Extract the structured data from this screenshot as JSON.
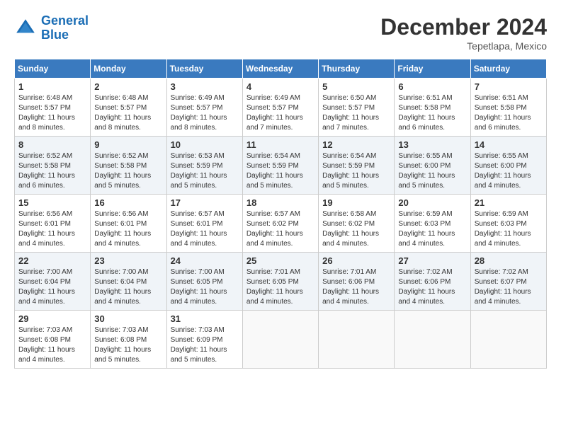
{
  "header": {
    "logo_line1": "General",
    "logo_line2": "Blue",
    "month": "December 2024",
    "location": "Tepetlapa, Mexico"
  },
  "weekdays": [
    "Sunday",
    "Monday",
    "Tuesday",
    "Wednesday",
    "Thursday",
    "Friday",
    "Saturday"
  ],
  "weeks": [
    [
      {
        "day": "1",
        "sunrise": "6:48 AM",
        "sunset": "5:57 PM",
        "daylight": "11 hours and 8 minutes."
      },
      {
        "day": "2",
        "sunrise": "6:48 AM",
        "sunset": "5:57 PM",
        "daylight": "11 hours and 8 minutes."
      },
      {
        "day": "3",
        "sunrise": "6:49 AM",
        "sunset": "5:57 PM",
        "daylight": "11 hours and 8 minutes."
      },
      {
        "day": "4",
        "sunrise": "6:49 AM",
        "sunset": "5:57 PM",
        "daylight": "11 hours and 7 minutes."
      },
      {
        "day": "5",
        "sunrise": "6:50 AM",
        "sunset": "5:57 PM",
        "daylight": "11 hours and 7 minutes."
      },
      {
        "day": "6",
        "sunrise": "6:51 AM",
        "sunset": "5:58 PM",
        "daylight": "11 hours and 6 minutes."
      },
      {
        "day": "7",
        "sunrise": "6:51 AM",
        "sunset": "5:58 PM",
        "daylight": "11 hours and 6 minutes."
      }
    ],
    [
      {
        "day": "8",
        "sunrise": "6:52 AM",
        "sunset": "5:58 PM",
        "daylight": "11 hours and 6 minutes."
      },
      {
        "day": "9",
        "sunrise": "6:52 AM",
        "sunset": "5:58 PM",
        "daylight": "11 hours and 5 minutes."
      },
      {
        "day": "10",
        "sunrise": "6:53 AM",
        "sunset": "5:59 PM",
        "daylight": "11 hours and 5 minutes."
      },
      {
        "day": "11",
        "sunrise": "6:54 AM",
        "sunset": "5:59 PM",
        "daylight": "11 hours and 5 minutes."
      },
      {
        "day": "12",
        "sunrise": "6:54 AM",
        "sunset": "5:59 PM",
        "daylight": "11 hours and 5 minutes."
      },
      {
        "day": "13",
        "sunrise": "6:55 AM",
        "sunset": "6:00 PM",
        "daylight": "11 hours and 5 minutes."
      },
      {
        "day": "14",
        "sunrise": "6:55 AM",
        "sunset": "6:00 PM",
        "daylight": "11 hours and 4 minutes."
      }
    ],
    [
      {
        "day": "15",
        "sunrise": "6:56 AM",
        "sunset": "6:01 PM",
        "daylight": "11 hours and 4 minutes."
      },
      {
        "day": "16",
        "sunrise": "6:56 AM",
        "sunset": "6:01 PM",
        "daylight": "11 hours and 4 minutes."
      },
      {
        "day": "17",
        "sunrise": "6:57 AM",
        "sunset": "6:01 PM",
        "daylight": "11 hours and 4 minutes."
      },
      {
        "day": "18",
        "sunrise": "6:57 AM",
        "sunset": "6:02 PM",
        "daylight": "11 hours and 4 minutes."
      },
      {
        "day": "19",
        "sunrise": "6:58 AM",
        "sunset": "6:02 PM",
        "daylight": "11 hours and 4 minutes."
      },
      {
        "day": "20",
        "sunrise": "6:59 AM",
        "sunset": "6:03 PM",
        "daylight": "11 hours and 4 minutes."
      },
      {
        "day": "21",
        "sunrise": "6:59 AM",
        "sunset": "6:03 PM",
        "daylight": "11 hours and 4 minutes."
      }
    ],
    [
      {
        "day": "22",
        "sunrise": "7:00 AM",
        "sunset": "6:04 PM",
        "daylight": "11 hours and 4 minutes."
      },
      {
        "day": "23",
        "sunrise": "7:00 AM",
        "sunset": "6:04 PM",
        "daylight": "11 hours and 4 minutes."
      },
      {
        "day": "24",
        "sunrise": "7:00 AM",
        "sunset": "6:05 PM",
        "daylight": "11 hours and 4 minutes."
      },
      {
        "day": "25",
        "sunrise": "7:01 AM",
        "sunset": "6:05 PM",
        "daylight": "11 hours and 4 minutes."
      },
      {
        "day": "26",
        "sunrise": "7:01 AM",
        "sunset": "6:06 PM",
        "daylight": "11 hours and 4 minutes."
      },
      {
        "day": "27",
        "sunrise": "7:02 AM",
        "sunset": "6:06 PM",
        "daylight": "11 hours and 4 minutes."
      },
      {
        "day": "28",
        "sunrise": "7:02 AM",
        "sunset": "6:07 PM",
        "daylight": "11 hours and 4 minutes."
      }
    ],
    [
      {
        "day": "29",
        "sunrise": "7:03 AM",
        "sunset": "6:08 PM",
        "daylight": "11 hours and 4 minutes."
      },
      {
        "day": "30",
        "sunrise": "7:03 AM",
        "sunset": "6:08 PM",
        "daylight": "11 hours and 5 minutes."
      },
      {
        "day": "31",
        "sunrise": "7:03 AM",
        "sunset": "6:09 PM",
        "daylight": "11 hours and 5 minutes."
      },
      null,
      null,
      null,
      null
    ]
  ]
}
